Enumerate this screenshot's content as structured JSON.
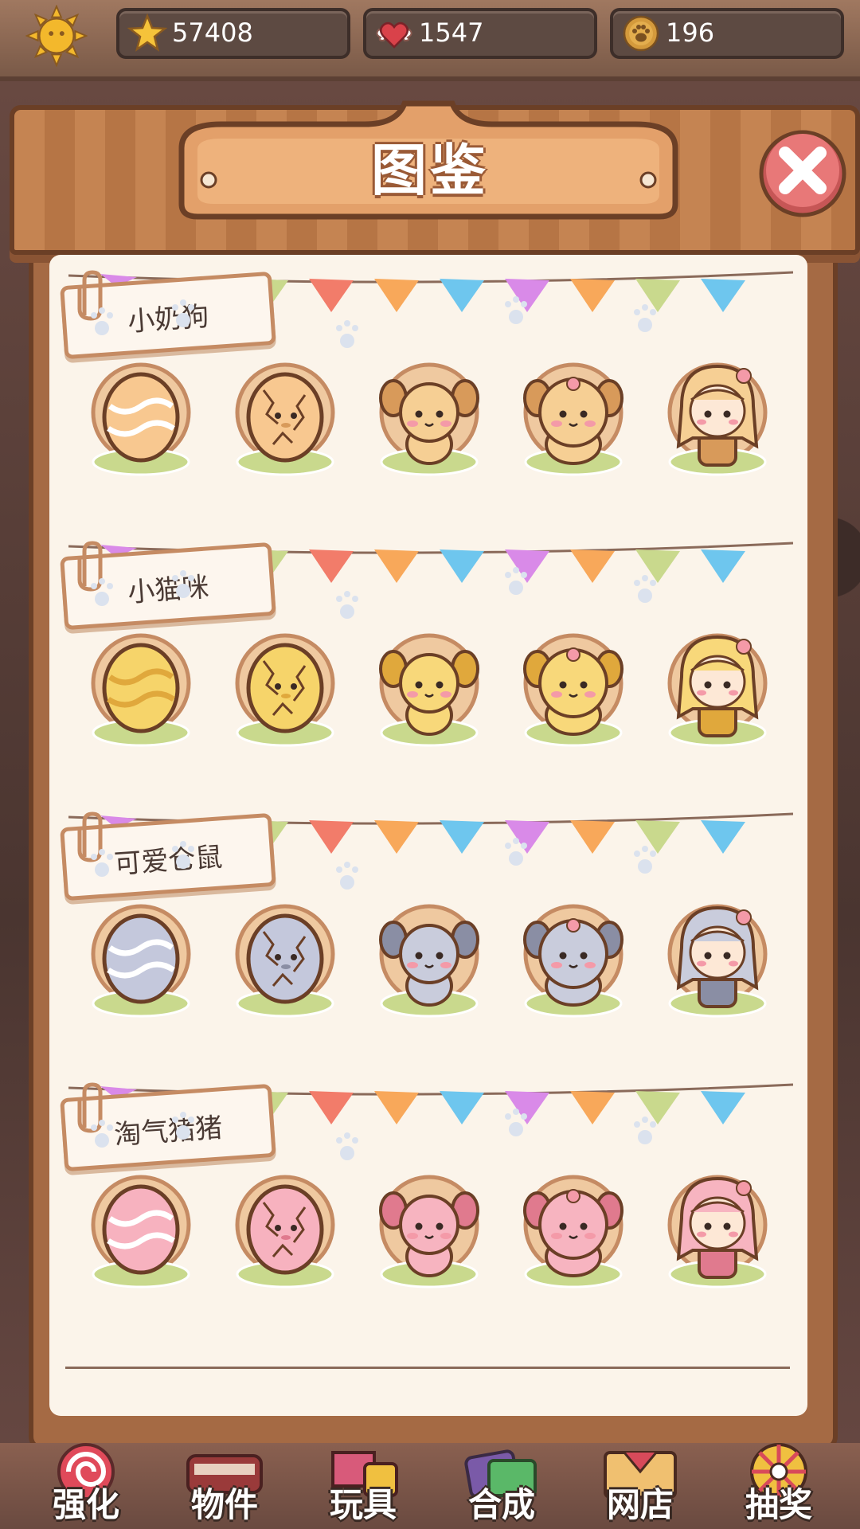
{
  "resources": {
    "stars": "57408",
    "hearts": "1547",
    "coins": "196"
  },
  "title": "图鉴",
  "icons": {
    "settings": "sun-icon",
    "stars": "star-icon",
    "hearts": "winged-heart-icon",
    "coins": "paw-coin-icon",
    "close": "close-icon"
  },
  "colors": {
    "wood": "#b67545",
    "paper": "#fbf4ea",
    "close_button": "#e26a6a",
    "grass": "#c9d98d"
  },
  "collections": [
    {
      "name": "小奶狗",
      "animal": "dog",
      "stages": [
        "egg",
        "cracked-egg",
        "puppy",
        "dog",
        "girl"
      ]
    },
    {
      "name": "小猫咪",
      "animal": "cat",
      "stages": [
        "egg",
        "cracked-egg",
        "kitten",
        "cat",
        "girl"
      ]
    },
    {
      "name": "可爱仓鼠",
      "animal": "hamster",
      "stages": [
        "egg",
        "cracked-egg",
        "baby-hamster",
        "hamster",
        "girl"
      ]
    },
    {
      "name": "淘气猪猪",
      "animal": "pig",
      "stages": [
        "egg",
        "cracked-egg",
        "piglet",
        "pig",
        "girl"
      ]
    }
  ],
  "nav": [
    {
      "label": "强化",
      "icon": "candy-icon"
    },
    {
      "label": "物件",
      "icon": "piano-icon"
    },
    {
      "label": "玩具",
      "icon": "toy-box-icon"
    },
    {
      "label": "合成",
      "icon": "merge-icon"
    },
    {
      "label": "网店",
      "icon": "shop-icon"
    },
    {
      "label": "抽奖",
      "icon": "lottery-wheel-icon"
    }
  ]
}
